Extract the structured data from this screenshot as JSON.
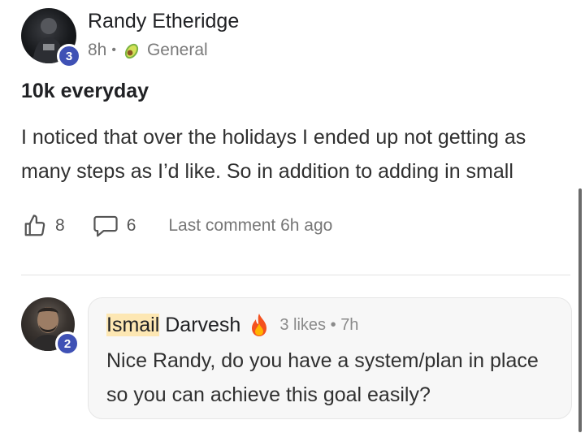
{
  "post": {
    "author": "Randy Etheridge",
    "level": "3",
    "time": "8h",
    "separator": "•",
    "category_icon": "avocado-icon",
    "category": "General",
    "title": "10k everyday",
    "body": "I noticed that over the holidays I ended up not getting as many steps as I’d like. So in addition to adding in small",
    "likes": "8",
    "comments": "6",
    "last_comment": "Last comment 6h ago"
  },
  "reply": {
    "name_highlight": "Ismail",
    "name_rest": " Darvesh",
    "level": "2",
    "badge_icon": "fire-icon",
    "likes": "3 likes",
    "separator": "•",
    "time": "7h",
    "text": "Nice Randy, do you have a system/plan in place so you can achieve this goal easily?"
  },
  "colors": {
    "level_badge": "#3f51b5",
    "name_highlight": "#fde7b3",
    "reply_background": "#f7f7f7"
  }
}
